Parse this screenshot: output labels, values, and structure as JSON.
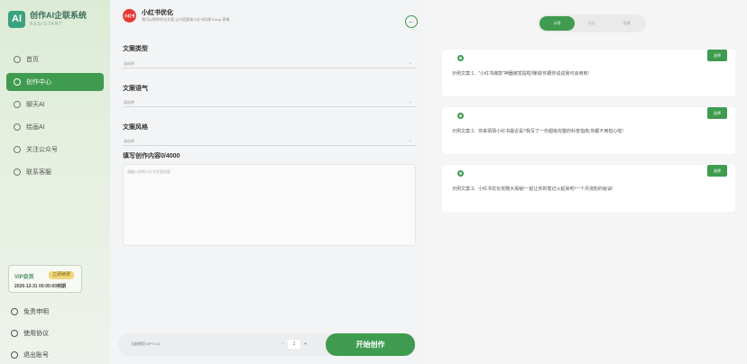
{
  "sidebar": {
    "brand_title": "创作AI企联系统",
    "brand_sub": "ASSISTANT",
    "brand_logo": "AI",
    "items": [
      {
        "label": "首页",
        "icon": "home-icon"
      },
      {
        "label": "创作中心",
        "icon": "edit-icon",
        "active": true
      },
      {
        "label": "聊天AI",
        "icon": "chat-icon"
      },
      {
        "label": "绘画AI",
        "icon": "paint-icon"
      },
      {
        "label": "关注公众号",
        "icon": "wechat-icon"
      },
      {
        "label": "联系客服",
        "icon": "service-icon"
      }
    ],
    "vip": {
      "label": "VIP会员",
      "badge": "立即续费",
      "expiry": "2026-12-31 00:00:00到期"
    },
    "bottom": [
      {
        "label": "免责申明",
        "icon": "info-icon"
      },
      {
        "label": "使用协议",
        "icon": "document-icon"
      },
      {
        "label": "退出账号",
        "icon": "power-icon"
      }
    ]
  },
  "form": {
    "logo_text": "小红书",
    "title": "小红书优化",
    "subtitle": "我可以帮你优化文案,让内容更具小红书风格 Emoji 表情",
    "back_icon": "back-arrow-icon",
    "fields": [
      {
        "label": "文案类型",
        "placeholder": "请选择"
      },
      {
        "label": "文案语气",
        "placeholder": "请选择"
      },
      {
        "label": "文案风格",
        "placeholder": "请选择"
      }
    ],
    "content_label": "填写创作内容0/4000",
    "content_placeholder": "请输入你的小红书文案内容",
    "footer_text": "当前模型:GPT-3.5",
    "stepper": {
      "minus": "-",
      "value": "1",
      "plus": "+"
    },
    "submit_label": "开始创作"
  },
  "results": {
    "tabs": [
      {
        "label": "示例",
        "active": true
      },
      {
        "label": "历史"
      },
      {
        "label": "收藏"
      }
    ],
    "cards": [
      {
        "text": "示例文案:1、\"小红书爆款\"神器被发掘啦!赚钱!你跟你说说我可会用到!",
        "button": "选择"
      },
      {
        "text": "示例文案:2、你来猜猜小红书最近是?我写了一份超级完整的科普指南,你都不用担心啦!",
        "button": "选择"
      },
      {
        "text": "示例文案:3、小红书优化攻略大揭秘!一起让你的笔记火起来吧!一个月涨粉的秘诀!",
        "button": "选择"
      }
    ]
  },
  "colors": {
    "accent": "#3f9b4f",
    "logo_red": "#e53935"
  }
}
